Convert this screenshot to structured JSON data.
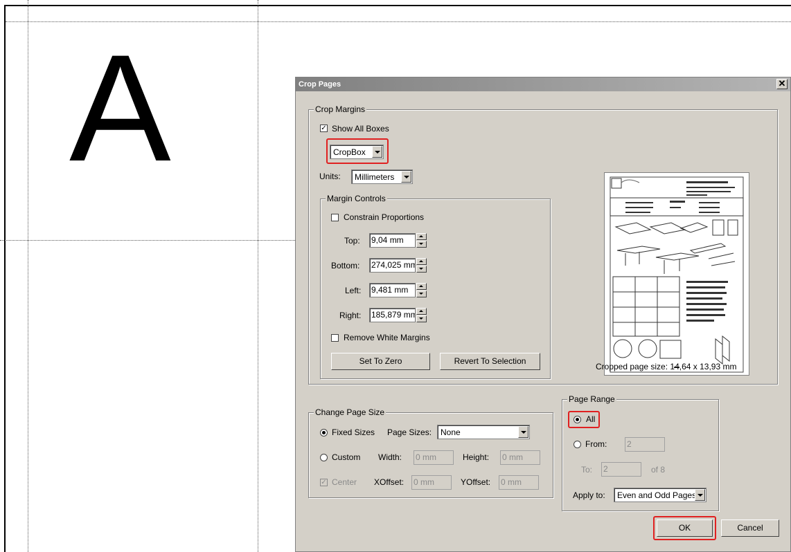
{
  "document": {
    "letter": "A"
  },
  "dialog": {
    "title": "Crop Pages",
    "close_symbol": "✕",
    "crop_margins": {
      "label": "Crop Margins",
      "show_all_boxes_label": "Show All Boxes",
      "show_all_boxes_checked": true,
      "box_select": "CropBox",
      "units_label": "Units:",
      "units_select": "Millimeters",
      "margin_controls": {
        "label": "Margin Controls",
        "constrain_label": "Constrain Proportions",
        "top_label": "Top:",
        "top_value": "9,04 mm",
        "bottom_label": "Bottom:",
        "bottom_value": "274,025 mm",
        "left_label": "Left:",
        "left_value": "9,481 mm",
        "right_label": "Right:",
        "right_value": "185,879 mm",
        "remove_white_label": "Remove White Margins",
        "set_zero_label": "Set To Zero",
        "revert_label": "Revert To Selection"
      },
      "cropped_size": "Cropped page size: 14,64 x 13,93 mm"
    },
    "change_page_size": {
      "label": "Change Page Size",
      "fixed_sizes_label": "Fixed Sizes",
      "page_sizes_label": "Page Sizes:",
      "page_sizes_value": "None",
      "custom_label": "Custom",
      "width_label": "Width:",
      "width_value": "0 mm",
      "height_label": "Height:",
      "height_value": "0 mm",
      "center_label": "Center",
      "xoffset_label": "XOffset:",
      "xoffset_value": "0 mm",
      "yoffset_label": "YOffset:",
      "yoffset_value": "0 mm"
    },
    "page_range": {
      "label": "Page Range",
      "all_label": "All",
      "from_label": "From:",
      "from_value": "2",
      "to_label": "To:",
      "to_value": "2",
      "of_label": "of 8",
      "apply_label": "Apply to:",
      "apply_value": "Even and Odd Pages"
    },
    "ok_label": "OK",
    "cancel_label": "Cancel"
  },
  "colors": {
    "highlight": "#e02020",
    "dialog_bg": "#d4d0c8"
  }
}
